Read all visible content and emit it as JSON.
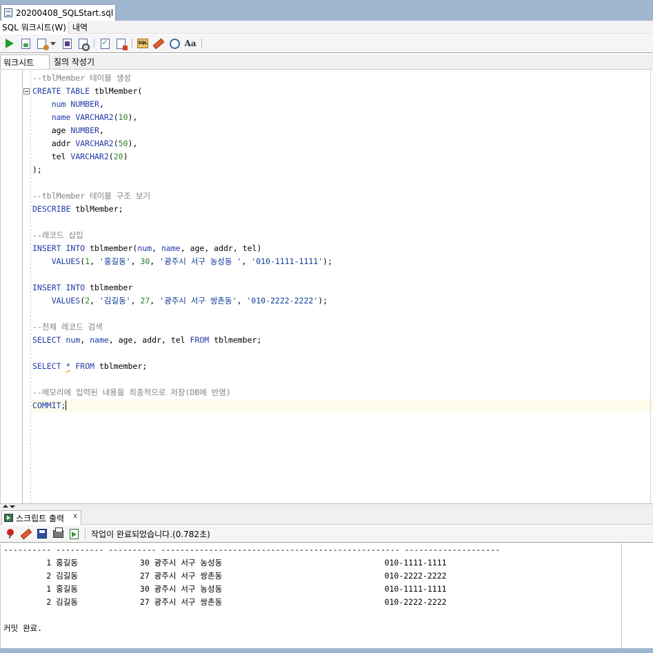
{
  "document_tab": {
    "title": "20200408_SQLStart.sql",
    "close": "×"
  },
  "sub_tabs": {
    "sql_worksheet": "SQL 워크시트(W)",
    "history": "내역"
  },
  "worksheet_tabs": {
    "worksheet": "워크시트",
    "query_builder": "질의 작성기"
  },
  "output_panel": {
    "tab_label": "스크립트 출력",
    "tab_close": "x",
    "status": "작업이 완료되었습니다.(0.782초)",
    "lines": [
      "---------- ---------- ---------- -------------------------------------------------- --------------------",
      "         1 홍길동             30 광주시 서구 농성동                                  010-1111-1111",
      "         2 김길동             27 광주시 서구 쌍촌동                                  010-2222-2222",
      "         1 홍길동             30 광주시 서구 농성동                                  010-1111-1111",
      "         2 김길동             27 광주시 서구 쌍촌동                                  010-2222-2222",
      "",
      "커밋 완료."
    ]
  },
  "editor": {
    "lines": [
      [
        {
          "t": "--tblMember 테이블 생성",
          "c": "cm"
        }
      ],
      [
        {
          "t": "CREATE TABLE ",
          "c": "kw"
        },
        {
          "t": "tblMember(",
          "c": "pl"
        }
      ],
      [
        {
          "t": "    num ",
          "c": "kw"
        },
        {
          "t": "NUMBER",
          "c": "kw"
        },
        {
          "t": ",",
          "c": "pl"
        }
      ],
      [
        {
          "t": "    name ",
          "c": "kw"
        },
        {
          "t": "VARCHAR2",
          "c": "kw"
        },
        {
          "t": "(",
          "c": "pl"
        },
        {
          "t": "10",
          "c": "nm"
        },
        {
          "t": "),",
          "c": "pl"
        }
      ],
      [
        {
          "t": "    age ",
          "c": "pl"
        },
        {
          "t": "NUMBER",
          "c": "kw"
        },
        {
          "t": ",",
          "c": "pl"
        }
      ],
      [
        {
          "t": "    addr ",
          "c": "pl"
        },
        {
          "t": "VARCHAR2",
          "c": "kw"
        },
        {
          "t": "(",
          "c": "pl"
        },
        {
          "t": "50",
          "c": "nm"
        },
        {
          "t": "),",
          "c": "pl"
        }
      ],
      [
        {
          "t": "    tel ",
          "c": "pl"
        },
        {
          "t": "VARCHAR2",
          "c": "kw"
        },
        {
          "t": "(",
          "c": "pl"
        },
        {
          "t": "20",
          "c": "nm"
        },
        {
          "t": ")",
          "c": "pl"
        }
      ],
      [
        {
          "t": ");",
          "c": "pl"
        }
      ],
      [],
      [
        {
          "t": "--tblMember 테이블 구조 보기",
          "c": "cm"
        }
      ],
      [
        {
          "t": "DESCRIBE ",
          "c": "kw"
        },
        {
          "t": "tblMember;",
          "c": "pl"
        }
      ],
      [],
      [
        {
          "t": "--레코드 삽입",
          "c": "cm"
        }
      ],
      [
        {
          "t": "INSERT INTO ",
          "c": "kw"
        },
        {
          "t": "tblmember(",
          "c": "pl"
        },
        {
          "t": "num",
          "c": "kw"
        },
        {
          "t": ", ",
          "c": "pl"
        },
        {
          "t": "name",
          "c": "kw"
        },
        {
          "t": ", age, addr, tel)",
          "c": "pl"
        }
      ],
      [
        {
          "t": "    VALUES",
          "c": "kw"
        },
        {
          "t": "(",
          "c": "pl"
        },
        {
          "t": "1",
          "c": "nm"
        },
        {
          "t": ", ",
          "c": "pl"
        },
        {
          "t": "'홍길동'",
          "c": "st"
        },
        {
          "t": ", ",
          "c": "pl"
        },
        {
          "t": "30",
          "c": "nm"
        },
        {
          "t": ", ",
          "c": "pl"
        },
        {
          "t": "'광주시 서구 농성동 '",
          "c": "st"
        },
        {
          "t": ", ",
          "c": "pl"
        },
        {
          "t": "'010-1111-1111'",
          "c": "st"
        },
        {
          "t": ");",
          "c": "pl"
        }
      ],
      [],
      [
        {
          "t": "INSERT INTO ",
          "c": "kw"
        },
        {
          "t": "tblmember",
          "c": "pl"
        }
      ],
      [
        {
          "t": "    VALUES",
          "c": "kw"
        },
        {
          "t": "(",
          "c": "pl"
        },
        {
          "t": "2",
          "c": "nm"
        },
        {
          "t": ", ",
          "c": "pl"
        },
        {
          "t": "'김길동'",
          "c": "st"
        },
        {
          "t": ", ",
          "c": "pl"
        },
        {
          "t": "27",
          "c": "nm"
        },
        {
          "t": ", ",
          "c": "pl"
        },
        {
          "t": "'광주시 서구 쌍촌동'",
          "c": "st"
        },
        {
          "t": ", ",
          "c": "pl"
        },
        {
          "t": "'010-2222-2222'",
          "c": "st"
        },
        {
          "t": ");",
          "c": "pl"
        }
      ],
      [],
      [
        {
          "t": "--전체 레코드 검색",
          "c": "cm"
        }
      ],
      [
        {
          "t": "SELECT ",
          "c": "kw"
        },
        {
          "t": "num",
          "c": "kw"
        },
        {
          "t": ", ",
          "c": "pl"
        },
        {
          "t": "name",
          "c": "kw"
        },
        {
          "t": ", age, addr, tel ",
          "c": "pl"
        },
        {
          "t": "FROM ",
          "c": "kw"
        },
        {
          "t": "tblmember;",
          "c": "pl"
        }
      ],
      [],
      [
        {
          "t": "SELECT ",
          "c": "kw"
        },
        {
          "t": "*",
          "c": "kw squig"
        },
        {
          "t": " ",
          "c": "pl"
        },
        {
          "t": "FROM ",
          "c": "kw"
        },
        {
          "t": "tblmember;",
          "c": "pl"
        }
      ],
      [],
      [
        {
          "t": "--메모리에 입력된 내용을 최종적으로 저장(DB에 반영)",
          "c": "cm"
        }
      ],
      [
        {
          "t": "COMMIT;",
          "c": "kw"
        },
        {
          "t": "",
          "c": "caret"
        }
      ]
    ]
  }
}
